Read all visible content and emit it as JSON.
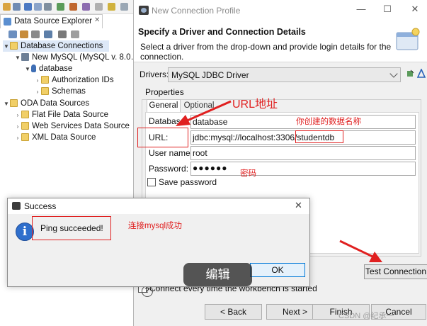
{
  "explorer": {
    "tab_title": "Data Source Explorer",
    "tree": {
      "database_connections": "Database Connections",
      "new_mysql": "New MySQL (MySQL v. 8.0…",
      "database": "database",
      "authorization_ids": "Authorization IDs",
      "schemas": "Schemas",
      "oda_data_sources": "ODA Data Sources",
      "flat_file": "Flat File Data Source",
      "web_services": "Web Services Data Source",
      "xml": "XML Data Source"
    }
  },
  "dialog": {
    "title": "New Connection Profile",
    "header_title": "Specify a Driver and Connection Details",
    "header_desc": "Select a driver from the drop-down and provide login details for the connection.",
    "drivers_label": "Drivers:",
    "driver_value": "MySQL JDBC Driver",
    "properties_label": "Properties",
    "tabs": {
      "general": "General",
      "optional": "Optional"
    },
    "fields": {
      "database_label": "Database:",
      "database_value": "database",
      "url_label": "URL:",
      "url_value": "jdbc:mysql://localhost:3306/studentdb",
      "username_label": "User name:",
      "username_value": "root",
      "password_label": "Password:",
      "password_value": "●●●●●●"
    },
    "save_password": "Save password",
    "test_connection": "Test Connection",
    "connect_every_time": "Connect every time the workbench is started",
    "buttons": {
      "help": "?",
      "back": "< Back",
      "next": "Next >",
      "finish": "Finish",
      "cancel": "Cancel"
    },
    "window_controls": {
      "minimize": "—",
      "maximize": "☐",
      "close": "✕"
    }
  },
  "success_popup": {
    "title": "Success",
    "message": "Ping succeeded!",
    "ok": "OK",
    "close": "✕"
  },
  "annotations": {
    "url_title": "URL地址",
    "db_name_note": "你创建的数据名称",
    "password_note": "密码",
    "mysql_ok_note": "连接mysql成功",
    "edit_label": "编辑",
    "watermark": "CSDN @纪承一"
  },
  "colors": {
    "annotation_red": "#e02020",
    "selection": "#dde8f7"
  }
}
